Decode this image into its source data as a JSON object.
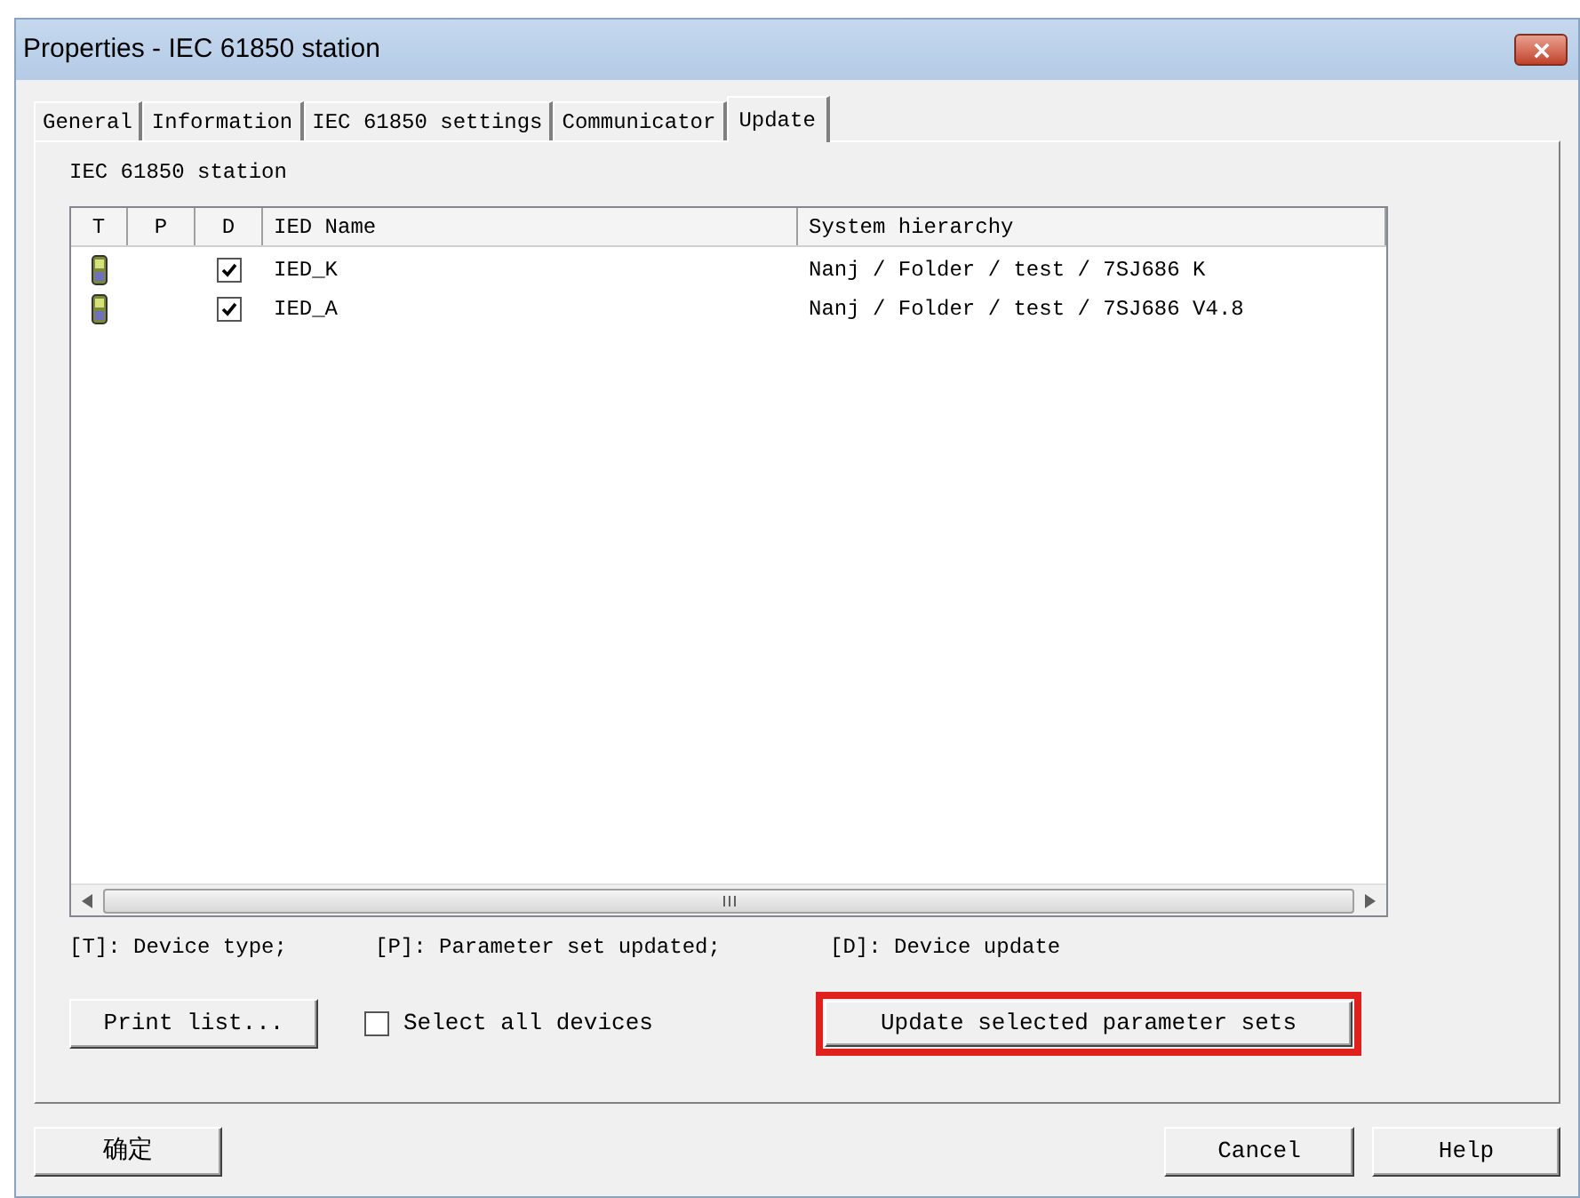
{
  "window": {
    "title": "Properties - IEC 61850 station"
  },
  "tabs": [
    {
      "label": "General",
      "selected": false
    },
    {
      "label": "Information",
      "selected": false
    },
    {
      "label": "IEC 61850 settings",
      "selected": false
    },
    {
      "label": "Communicator",
      "selected": false
    },
    {
      "label": "Update",
      "selected": true
    }
  ],
  "group_label": "IEC 61850 station",
  "table": {
    "columns": [
      "T",
      "P",
      "D",
      "IED Name",
      "System hierarchy"
    ],
    "rows": [
      {
        "device_update": true,
        "name": "IED_K",
        "hierarchy": "Nanj / Folder / test / 7SJ686 K"
      },
      {
        "device_update": true,
        "name": "IED_A",
        "hierarchy": "Nanj / Folder / test / 7SJ686 V4.8"
      }
    ]
  },
  "legend": [
    "[T]: Device type;",
    "[P]: Parameter set updated;",
    "[D]: Device update"
  ],
  "print_button": "Print list...",
  "select_all": {
    "label": "Select all devices",
    "checked": false
  },
  "update_button": {
    "label": "Update selected parameter sets",
    "highlighted": true
  },
  "footer_buttons": {
    "ok": "确定",
    "cancel": "Cancel",
    "help": "Help"
  }
}
